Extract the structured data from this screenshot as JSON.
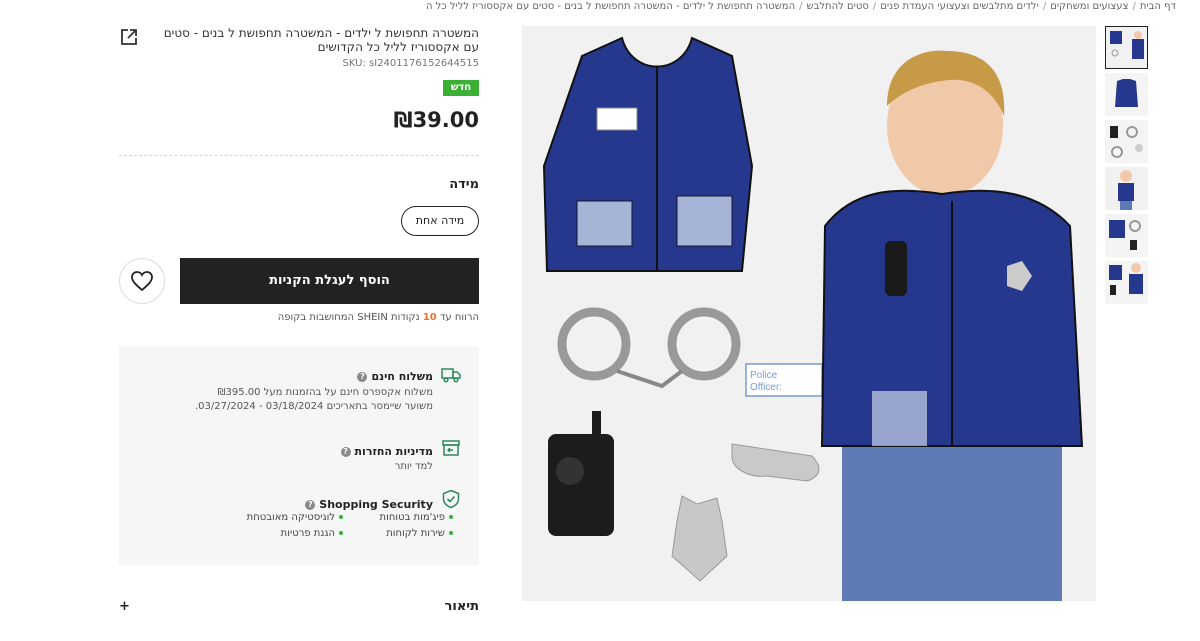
{
  "breadcrumb": [
    "דף הבית",
    "צעצועים ומשחקים",
    "ילדים מתלבשים וצעצועי העמדת פנים",
    "סטים להתלבש",
    "המשטרה תחפושת ל ילדים - המשטרה תחפושת ל בנים - סטים עם אקססוריז לליל כל הקדושים"
  ],
  "product": {
    "title": "המשטרה תחפושת ל ילדים - המשטרה תחפושת ל בנים - סטים עם אקססוריז לליל כל הקדושים",
    "sku": "SKU: sI2401176152644515",
    "badge": "חדש",
    "price": "₪39.00"
  },
  "size": {
    "label": "מידה",
    "option": "מידה אחת"
  },
  "actions": {
    "add_to_cart": "הוסף לעגלת הקניות",
    "points_prefix": "הרווח עד",
    "points_value": "10",
    "points_suffix": "נקודות SHEIN המחושבות בקופה"
  },
  "policies": {
    "shipping_title": "משלוח חינם",
    "shipping_line1": "משלוח אקספרס חינם על בהזמנות מעל ₪395.00",
    "shipping_line2": "משוער שיימסר בתאריכים 03/18/2024 - 03/27/2024.",
    "returns_title": "מדיניות החזרות",
    "returns_link": "למד יותר",
    "security_title": "Shopping Security",
    "security_items": [
      "פיג'מות בטוחות",
      "לוגיסטיקה מאובטחת",
      "שירות לקוחות",
      "הגנת פרטיות"
    ]
  },
  "description": {
    "label": "תיאור",
    "expand": "+"
  },
  "image": {
    "card_text_1": "Police",
    "card_text_2": "Officer:"
  },
  "colors": {
    "accent_green": "#3cb035",
    "dark": "#222222",
    "vest_blue": "#23388f",
    "points_orange": "#e8742b"
  }
}
